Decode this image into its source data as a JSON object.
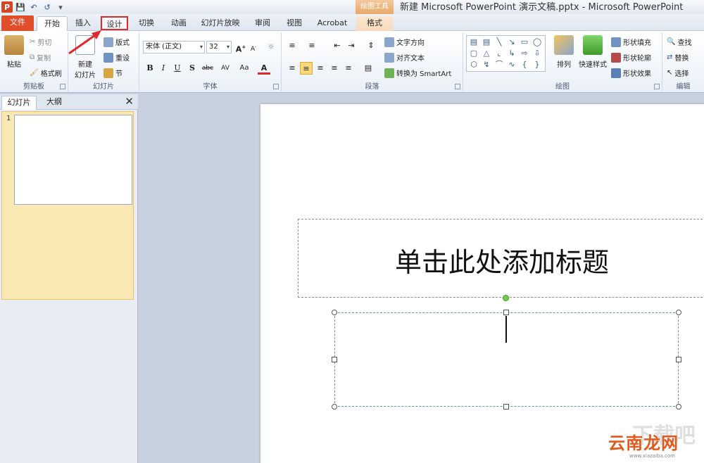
{
  "window": {
    "title": "新建 Microsoft PowerPoint 演示文稿.pptx - Microsoft PowerPoint",
    "context_group": "绘图工具"
  },
  "tabs": [
    "文件",
    "开始",
    "插入",
    "设计",
    "切换",
    "动画",
    "幻灯片放映",
    "审阅",
    "视图",
    "Acrobat",
    "格式"
  ],
  "ribbon": {
    "clipboard": {
      "paste": "粘贴",
      "cut": "剪切",
      "copy": "复制",
      "format_painter": "格式刷",
      "label": "剪贴板"
    },
    "slides": {
      "new_slide": "新建\n幻灯片",
      "layout": "版式",
      "reset": "重设",
      "section": "节",
      "label": "幻灯片"
    },
    "font": {
      "font_name": "宋体 (正文)",
      "font_size": "32",
      "label": "字体",
      "bold": "B",
      "italic": "I",
      "underline": "U",
      "shadow": "S",
      "strike": "abc",
      "spacing": "AV",
      "case": "Aa",
      "color": "A"
    },
    "paragraph": {
      "text_direction": "文字方向",
      "align_text": "对齐文本",
      "smartart": "转换为 SmartArt",
      "label": "段落"
    },
    "drawing": {
      "arrange": "排列",
      "quick_styles": "快速样式",
      "shape_fill": "形状填充",
      "shape_outline": "形状轮廓",
      "shape_effects": "形状效果",
      "label": "绘图"
    },
    "editing": {
      "find": "查找",
      "replace": "替换",
      "select": "选择",
      "label": "编辑"
    }
  },
  "panel": {
    "tab_slides": "幻灯片",
    "tab_outline": "大纲",
    "slide_number": "1"
  },
  "slide": {
    "title_placeholder": "单击此处添加标题"
  },
  "watermark": {
    "text": "云南龙网",
    "small": "www.xiazaiba.com"
  },
  "colors": {
    "file_tab": "#e14f2a",
    "highlight": "#e02a2a",
    "context": "#e9a96a"
  }
}
